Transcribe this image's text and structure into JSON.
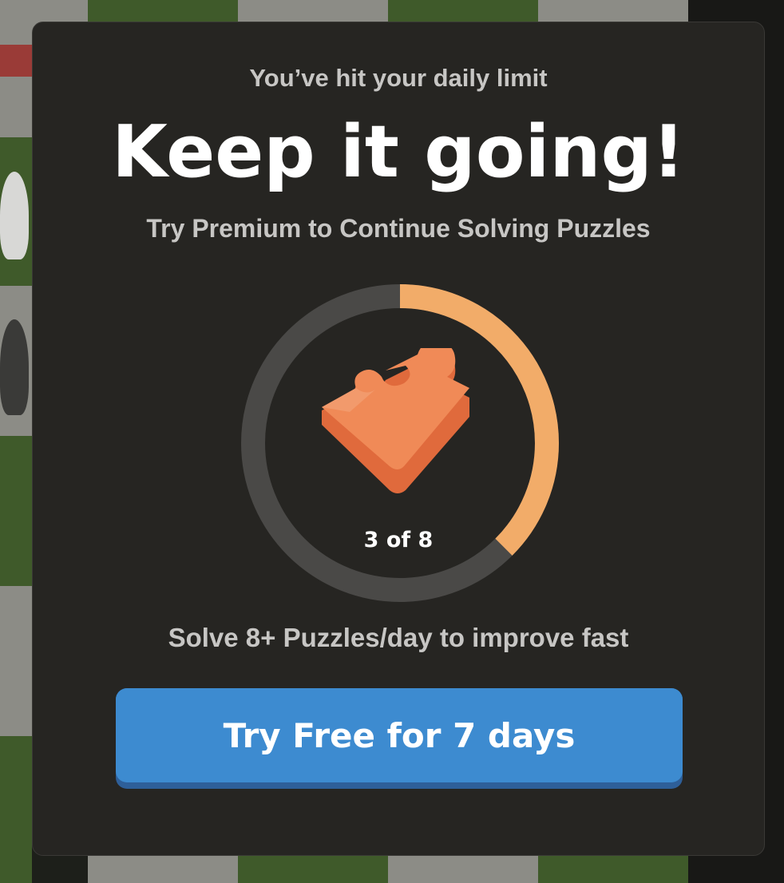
{
  "modal": {
    "eyebrow": "You’ve hit your daily limit",
    "headline": "Keep it going!",
    "subtitle": "Try Premium to Continue Solving Puzzles",
    "progress": {
      "solved": 3,
      "limit": 8,
      "label": "3 of 8",
      "fraction": 0.375,
      "track_color": "#4a4947",
      "fill_color": "#f2ac69"
    },
    "icon": "puzzle-piece-icon",
    "tagline": "Solve 8+ Puzzles/day to improve fast",
    "cta_label": "Try Free for 7 days",
    "cta_color": "#3d8bd0"
  },
  "colors": {
    "modal_bg": "#262522",
    "board_light": "#ebecd0",
    "board_dark": "#779556"
  }
}
